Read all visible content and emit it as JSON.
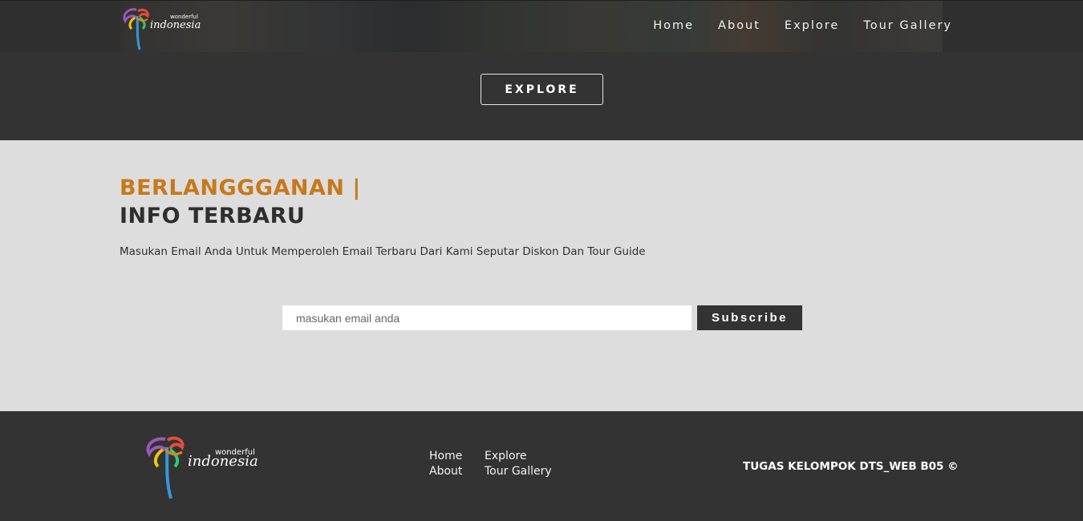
{
  "brand": {
    "logo_small": "wonderful indonesia",
    "logo_top_word": "wonderful",
    "logo_main_word": "indonesia"
  },
  "nav": {
    "items": [
      {
        "label": "Home"
      },
      {
        "label": "About"
      },
      {
        "label": "Explore"
      },
      {
        "label": "Tour Gallery"
      }
    ]
  },
  "hero": {
    "explore_button": "EXPLORE"
  },
  "subscribe": {
    "title_line1": "BERLANGGGANAN |",
    "title_line2": "INFO TERBARU",
    "description": "Masukan Email Anda Untuk Memperoleh Email Terbaru Dari Kami Seputar Diskon Dan Tour Guide",
    "email_placeholder": "masukan email anda",
    "email_value": "",
    "button": "Subscribe"
  },
  "footer": {
    "links": [
      {
        "label": "Home"
      },
      {
        "label": "Explore"
      },
      {
        "label": "About"
      },
      {
        "label": "Tour Gallery"
      }
    ],
    "copyright": "TUGAS KELOMPOK DTS_WEB B05 ©"
  },
  "colors": {
    "accent": "#c8781a",
    "dark": "#333333",
    "light": "#dddddd"
  },
  "icons": {
    "logo": "wonderful-indonesia-bird-logo"
  }
}
